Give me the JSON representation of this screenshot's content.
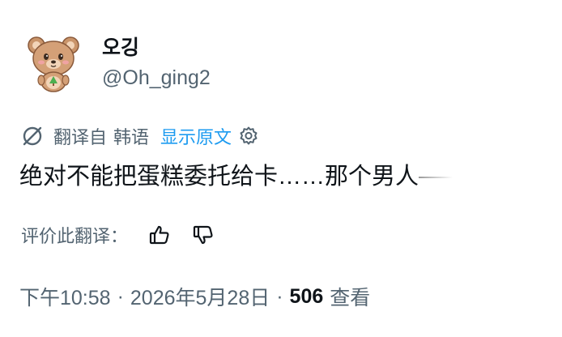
{
  "user": {
    "display_name": "오깅",
    "handle": "@Oh_ging2"
  },
  "translation": {
    "translated_from": "翻译自",
    "source_language": "韩语",
    "show_original": "显示原文"
  },
  "tweet": {
    "text": "绝对不能把蛋糕委托给卡……那个男人"
  },
  "rating": {
    "label": "评价此翻译："
  },
  "meta": {
    "time": "下午10:58",
    "date": "2026年5月28日",
    "separator": "·",
    "views_count": "506",
    "views_label": "查看"
  },
  "icons": {
    "avatar": "bear-avatar-icon",
    "translate": "globe-icon",
    "settings": "gear-icon",
    "thumbs_up": "thumbs-up-icon",
    "thumbs_down": "thumbs-down-icon"
  },
  "colors": {
    "text": "#0f1419",
    "secondary": "#536471",
    "link": "#1d9bf0"
  }
}
